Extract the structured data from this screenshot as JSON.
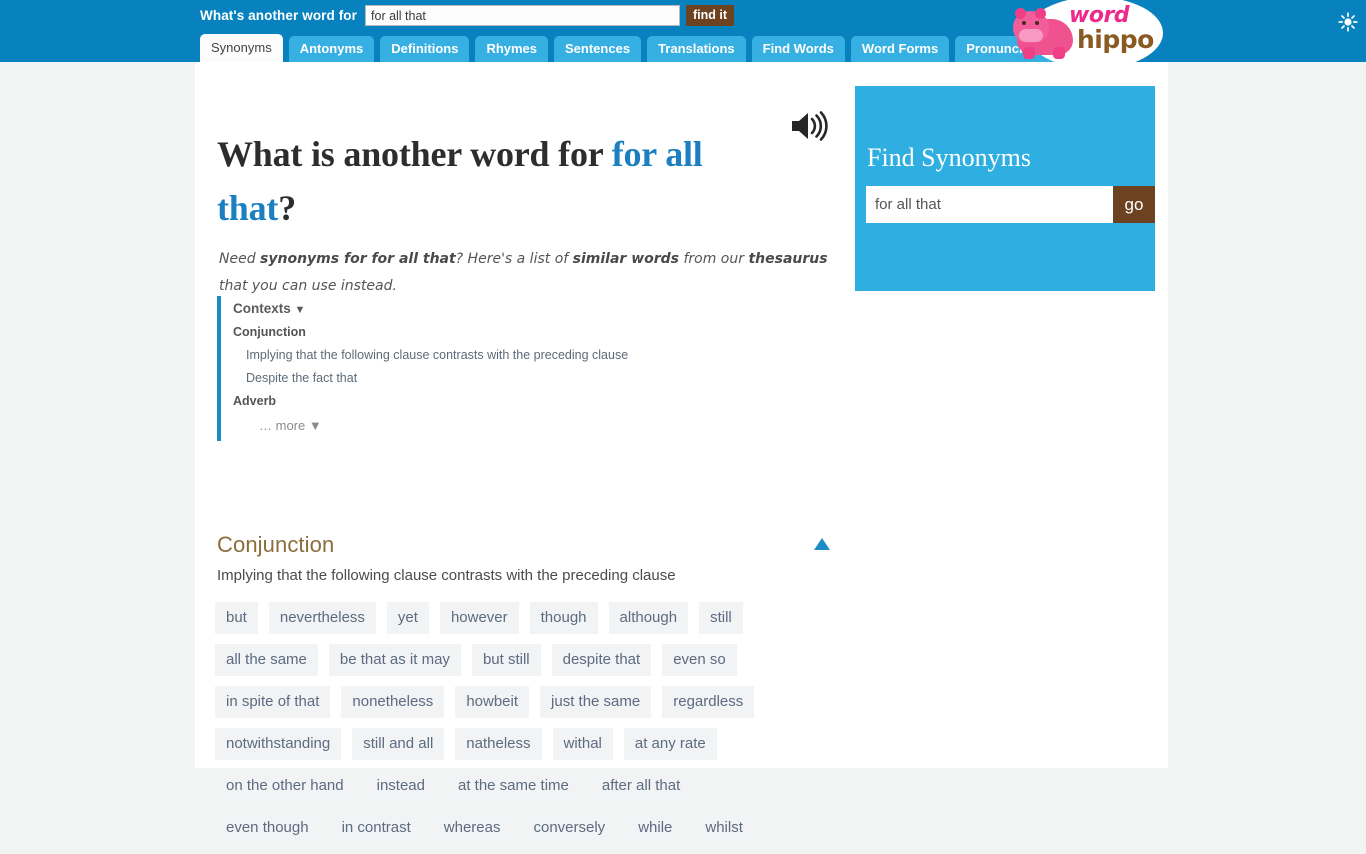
{
  "header": {
    "search_label": "What's another word for",
    "search_value": "for all that",
    "search_placeholder": "",
    "find_button": "find it",
    "brightness_icon": "sun-icon",
    "logo": {
      "word": "word",
      "hippo": "hippo"
    },
    "tabs": [
      {
        "label": "Synonyms",
        "active": true
      },
      {
        "label": "Antonyms",
        "active": false
      },
      {
        "label": "Definitions",
        "active": false
      },
      {
        "label": "Rhymes",
        "active": false
      },
      {
        "label": "Sentences",
        "active": false
      },
      {
        "label": "Translations",
        "active": false
      },
      {
        "label": "Find Words",
        "active": false
      },
      {
        "label": "Word Forms",
        "active": false
      },
      {
        "label": "Pronunciations",
        "active": false
      }
    ]
  },
  "main": {
    "title_prefix": "What is another word for ",
    "title_term": "for all that",
    "title_suffix": "?",
    "speaker_icon": "speaker-icon",
    "lede_1": "Need ",
    "lede_b1": "synonyms for for all that",
    "lede_2": "? Here's a list of ",
    "lede_b2": "similar words",
    "lede_3": " from our ",
    "lede_b3": "thesaurus",
    "lede_4": " that you can use instead.",
    "contexts": {
      "title": "Contexts",
      "caret": "▼",
      "groups": [
        {
          "pos": "Conjunction",
          "senses": [
            "Implying that the following clause contrasts with the preceding clause",
            "Despite the fact that"
          ]
        },
        {
          "pos": "Adverb",
          "senses": []
        }
      ],
      "more_label": "… more ▼"
    },
    "section": {
      "title": "Conjunction",
      "subtitle": "Implying that the following clause contrasts with the preceding clause",
      "collapse_icon": "collapse-triangle-up-icon"
    },
    "synonym_rows": [
      [
        "but",
        "nevertheless",
        "yet",
        "however",
        "though",
        "although",
        "still"
      ],
      [
        "all the same",
        "be that as it may",
        "but still",
        "despite that",
        "even so"
      ],
      [
        "in spite of that",
        "nonetheless",
        "howbeit",
        "just the same",
        "regardless"
      ],
      [
        "notwithstanding",
        "still and all",
        "natheless",
        "withal",
        "at any rate"
      ],
      [
        "on the other hand",
        "instead",
        "at the same time",
        "after all that"
      ],
      [
        "even though",
        "in contrast",
        "whereas",
        "conversely",
        "while",
        "whilst"
      ]
    ]
  },
  "sidebar": {
    "title": "Find Synonyms",
    "input_value": "for all that",
    "input_placeholder": "",
    "go_label": "go"
  },
  "colors": {
    "header_blue": "#0782bf",
    "tab_blue": "#36b0e2",
    "accent_blue": "#1b8cc4",
    "brown": "#6d4220",
    "sidebox_blue": "#2eaee1",
    "section_brown": "#8a6e3c",
    "chip_bg": "#f2f3f5",
    "chip_text": "#5d6b80"
  }
}
